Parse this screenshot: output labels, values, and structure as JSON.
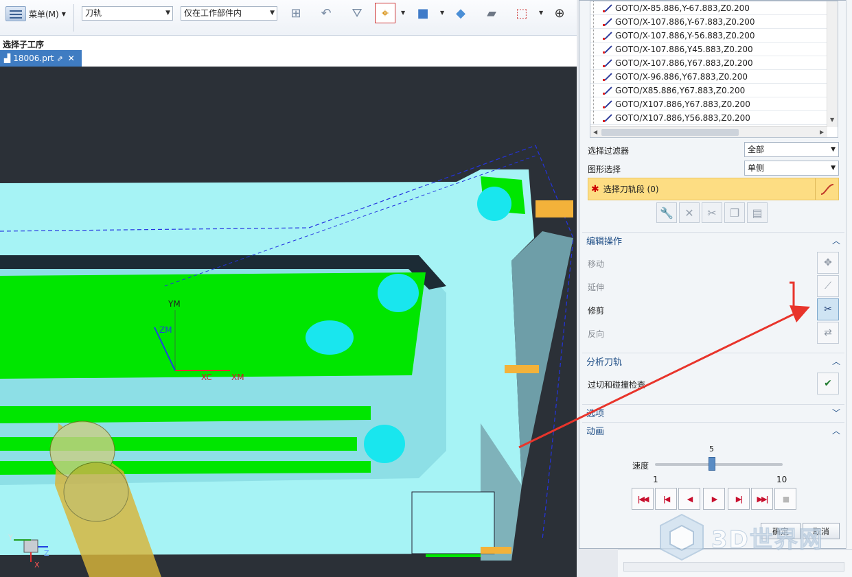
{
  "toolbar": {
    "menu_label": "菜单(M)",
    "type_filter": "刀轨",
    "scope_filter": "仅在工作部件内"
  },
  "navigator": {
    "subop_label": "选择子工序"
  },
  "tab": {
    "file_name": "18006.prt"
  },
  "viewport": {
    "wcs_labels": {
      "ym": "YM",
      "zm": "ZM",
      "xc": "XC",
      "xm": "XM"
    },
    "triad": {
      "y": "Y",
      "z": "Z",
      "x": "X"
    }
  },
  "dialog": {
    "segments": [
      "GOTO/X-85.886,Y-67.883,Z0.200",
      "GOTO/X-107.886,Y-67.883,Z0.200",
      "GOTO/X-107.886,Y-56.883,Z0.200",
      "GOTO/X-107.886,Y45.883,Z0.200",
      "GOTO/X-107.886,Y67.883,Z0.200",
      "GOTO/X-96.886,Y67.883,Z0.200",
      "GOTO/X85.886,Y67.883,Z0.200",
      "GOTO/X107.886,Y67.883,Z0.200",
      "GOTO/X107.886,Y56.883,Z0.200"
    ],
    "filter_label": "选择过滤器",
    "filter_value": "全部",
    "graphic_label": "图形选择",
    "graphic_value": "单侧",
    "select_segment_label": "选择刀轨段 (0)",
    "edit_group": {
      "title": "编辑操作",
      "move": "移动",
      "extend": "延伸",
      "trim": "修剪",
      "reverse": "反向"
    },
    "analyze_group": {
      "title": "分析刀轨",
      "gouge_check": "过切和碰撞检查"
    },
    "options_group": {
      "title": "选项"
    },
    "animation_group": {
      "title": "动画",
      "speed_label": "速度",
      "speed_value": "5",
      "speed_min": "1",
      "speed_max": "10",
      "speed_fraction": 0.444
    },
    "ok_label": "确定",
    "cancel_label": "取消"
  },
  "watermark": {
    "text": "3D世界网"
  },
  "colors": {
    "viewport_bg": "#2b3037",
    "part_cyan": "#a6f3f5",
    "toolpath_green": "#00e600",
    "highlight_yellow": "#fddd83",
    "tab_blue": "#3f7cc2",
    "annotation_red": "#e8342b"
  }
}
